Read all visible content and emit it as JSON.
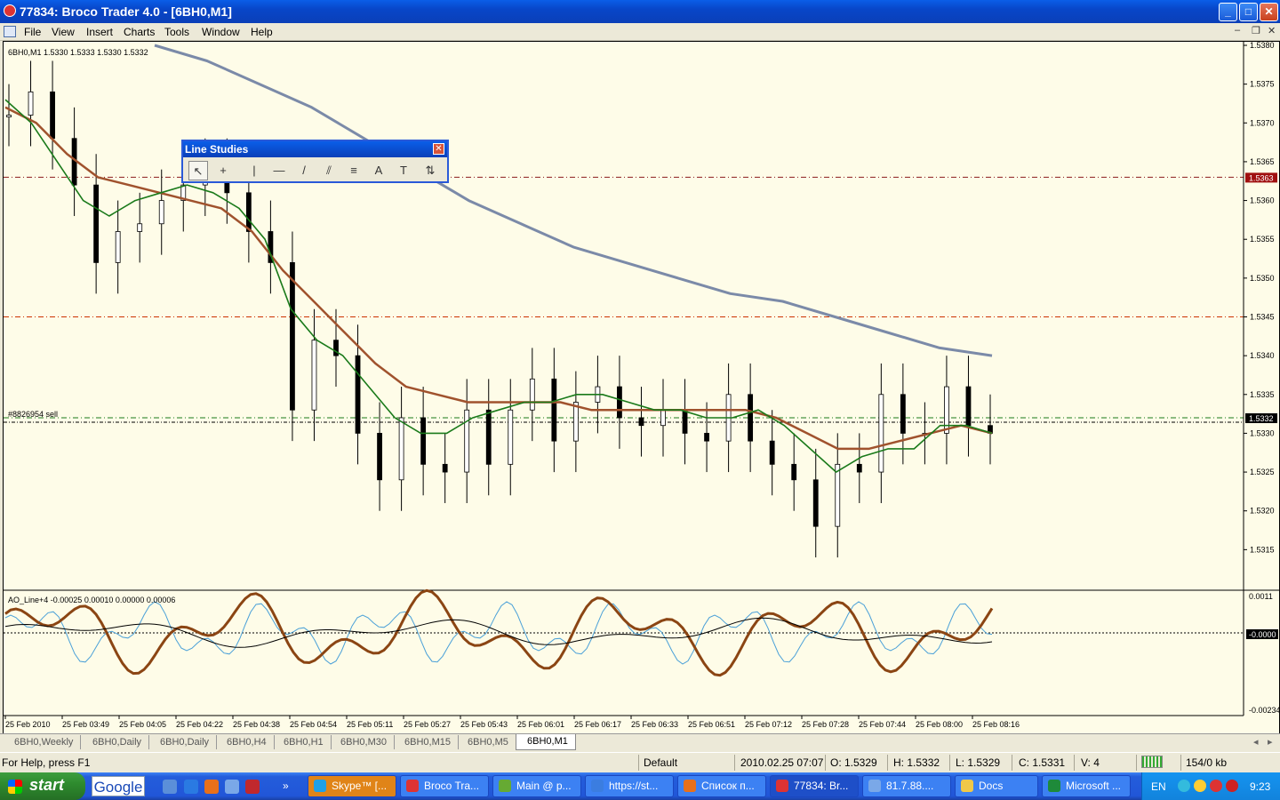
{
  "window": {
    "title": "77834: Broco Trader 4.0 - [6BH0,M1]",
    "controls": [
      "_",
      "□",
      "✕"
    ]
  },
  "menu": [
    "File",
    "View",
    "Insert",
    "Charts",
    "Tools",
    "Window",
    "Help"
  ],
  "chart": {
    "header": "6BH0,M1  1.5330 1.5333 1.5330 1.5332",
    "order_label": "#8826954 sell",
    "price_axis": [
      "1.5380",
      "1.5375",
      "1.5370",
      "1.5365",
      "1.5360",
      "1.5355",
      "1.5350",
      "1.5345",
      "1.5340",
      "1.5335",
      "1.5330",
      "1.5325",
      "1.5320",
      "1.5315"
    ],
    "price_min": 1.531,
    "price_max": 1.538,
    "current_price_marker": "1.5332",
    "hline_marker": "1.5363",
    "hline_red": 1.5345,
    "hline_marker_value": 1.5363,
    "hline_order": 1.5332,
    "time_axis": [
      "25 Feb 2010",
      "25 Feb 03:49",
      "25 Feb 04:05",
      "25 Feb 04:22",
      "25 Feb 04:38",
      "25 Feb 04:54",
      "25 Feb 05:11",
      "25 Feb 05:27",
      "25 Feb 05:43",
      "25 Feb 06:01",
      "25 Feb 06:17",
      "25 Feb 06:33",
      "25 Feb 06:51",
      "25 Feb 07:12",
      "25 Feb 07:28",
      "25 Feb 07:44",
      "25 Feb 08:00",
      "25 Feb 08:16"
    ],
    "closes": [
      1.5371,
      1.5374,
      1.5368,
      1.5362,
      1.5352,
      1.5356,
      1.5357,
      1.536,
      1.5362,
      1.5364,
      1.5361,
      1.5356,
      1.5352,
      1.5333,
      1.5342,
      1.534,
      1.533,
      1.5324,
      1.5332,
      1.5326,
      1.5325,
      1.5333,
      1.5326,
      1.5333,
      1.5337,
      1.5329,
      1.5334,
      1.5336,
      1.5332,
      1.5331,
      1.5333,
      1.533,
      1.5329,
      1.5335,
      1.5329,
      1.5326,
      1.5324,
      1.5318,
      1.5326,
      1.5325,
      1.5335,
      1.533,
      1.533,
      1.5336,
      1.5331,
      1.533
    ],
    "ma_fast": [
      1.5373,
      1.537,
      1.5365,
      1.536,
      1.5358,
      1.536,
      1.5361,
      1.5362,
      1.5361,
      1.5359,
      1.5355,
      1.5346,
      1.5342,
      1.534,
      1.5336,
      1.5332,
      1.533,
      1.533,
      1.5332,
      1.5333,
      1.5334,
      1.5334,
      1.5335,
      1.5335,
      1.5334,
      1.5333,
      1.5333,
      1.5332,
      1.5332,
      1.5333,
      1.5331,
      1.5328,
      1.5325,
      1.5327,
      1.5328,
      1.5328,
      1.5331,
      1.5331,
      1.533
    ],
    "ma_mid": [
      1.5372,
      1.537,
      1.5366,
      1.5363,
      1.5362,
      1.5361,
      1.536,
      1.5359,
      1.5356,
      1.5351,
      1.5347,
      1.5343,
      1.5339,
      1.5336,
      1.5335,
      1.5334,
      1.5334,
      1.5334,
      1.5334,
      1.5333,
      1.5333,
      1.5333,
      1.5333,
      1.5333,
      1.5333,
      1.5332,
      1.533,
      1.5328,
      1.5328,
      1.5329,
      1.533,
      1.5331,
      1.533
    ],
    "ma_slow": [
      1.538,
      1.5378,
      1.5375,
      1.5372,
      1.5368,
      1.5364,
      1.536,
      1.5357,
      1.5354,
      1.5352,
      1.535,
      1.5348,
      1.5347,
      1.5345,
      1.5343,
      1.5341,
      1.534
    ],
    "colors": {
      "background": "#fefce8",
      "ma_fast": "#1a7a1a",
      "ma_mid": "#a0522d",
      "ma_slow": "#7b8aa8",
      "candle": "#000000",
      "hline_red": "#cc3300",
      "hline_order": "#1a7a1a"
    }
  },
  "indicator": {
    "header": "AO_Line+4 -0.00025 0.00010 0.00000 0.00006",
    "axis_top": "0.0011",
    "axis_zero": "-0.0000",
    "axis_bottom": "-0.00234",
    "colors": {
      "thick": "#8b4513",
      "thin": "#4aa0d8",
      "signal": "#000000"
    }
  },
  "line_studies": {
    "title": "Line Studies",
    "tools": [
      "cursor-icon",
      "crosshair-icon",
      "vertical-line-icon",
      "horizontal-line-icon",
      "trendline-icon",
      "equidistant-channel-icon",
      "fibonacci-icon",
      "text-icon",
      "text-label-icon",
      "arrows-icon"
    ],
    "tool_glyphs": [
      "↖",
      "+",
      "|",
      "—",
      "/",
      "⫽",
      "≡",
      "A",
      "T",
      "⇅"
    ]
  },
  "tabs": [
    "6BH0,Weekly",
    "6BH0,Daily",
    "6BH0,Daily",
    "6BH0,H4",
    "6BH0,H1",
    "6BH0,M30",
    "6BH0,M15",
    "6BH0,M5",
    "6BH0,M1"
  ],
  "status": {
    "help": "For Help, press F1",
    "profile": "Default",
    "datetime": "2010.02.25 07:07",
    "open": "O: 1.5329",
    "high": "H: 1.5332",
    "low": "L: 1.5329",
    "close": "C: 1.5331",
    "volume": "V: 4",
    "traffic": "154/0 kb"
  },
  "taskbar": {
    "start": "start",
    "google": "Google",
    "buttons": [
      "Skype™ [...",
      "Broco Tra...",
      "Main @ p...",
      "https://st...",
      "Список п...",
      "77834: Br...",
      "81.7.88....",
      "Docs",
      "Microsoft ..."
    ],
    "lang": "EN",
    "time": "9:23"
  }
}
